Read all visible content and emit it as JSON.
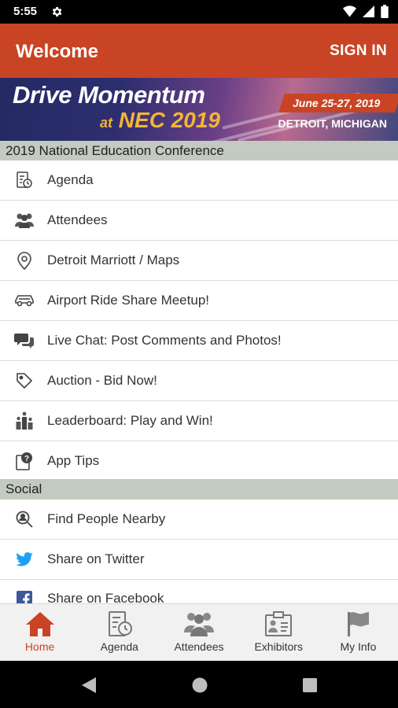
{
  "status_bar": {
    "time": "5:55"
  },
  "app_bar": {
    "title": "Welcome",
    "sign_in": "SIGN IN"
  },
  "banner": {
    "headline_1": "Drive Momentum",
    "headline_2_prefix": "at",
    "headline_2": "NEC 2019",
    "dates": "June 25-27, 2019",
    "location": "DETROIT, MICHIGAN"
  },
  "sections": {
    "conference": {
      "header": "2019 National Education Conference",
      "items": [
        {
          "label": "Agenda",
          "icon": "agenda-icon"
        },
        {
          "label": "Attendees",
          "icon": "attendees-icon"
        },
        {
          "label": "Detroit Marriott / Maps",
          "icon": "map-pin-icon"
        },
        {
          "label": "Airport Ride Share Meetup!",
          "icon": "car-icon"
        },
        {
          "label": "Live Chat: Post Comments and Photos!",
          "icon": "chat-icon"
        },
        {
          "label": "Auction - Bid Now!",
          "icon": "tag-icon"
        },
        {
          "label": "Leaderboard: Play and Win!",
          "icon": "leaderboard-icon"
        },
        {
          "label": "App Tips",
          "icon": "help-icon"
        }
      ]
    },
    "social": {
      "header": "Social",
      "items": [
        {
          "label": "Find People Nearby",
          "icon": "people-search-icon"
        },
        {
          "label": "Share on Twitter",
          "icon": "twitter-icon"
        },
        {
          "label": "Share on Facebook",
          "icon": "facebook-icon"
        }
      ]
    }
  },
  "bottom_nav": [
    {
      "label": "Home",
      "icon": "home-icon",
      "active": true
    },
    {
      "label": "Agenda",
      "icon": "agenda-icon"
    },
    {
      "label": "Attendees",
      "icon": "attendees-icon"
    },
    {
      "label": "Exhibitors",
      "icon": "exhibitors-icon"
    },
    {
      "label": "My Info",
      "icon": "flag-icon"
    }
  ],
  "colors": {
    "brand": "#c94424",
    "section_header_bg": "#c3cac0",
    "twitter": "#1da1f2",
    "facebook": "#3b5998",
    "banner_gold": "#f2b632"
  }
}
